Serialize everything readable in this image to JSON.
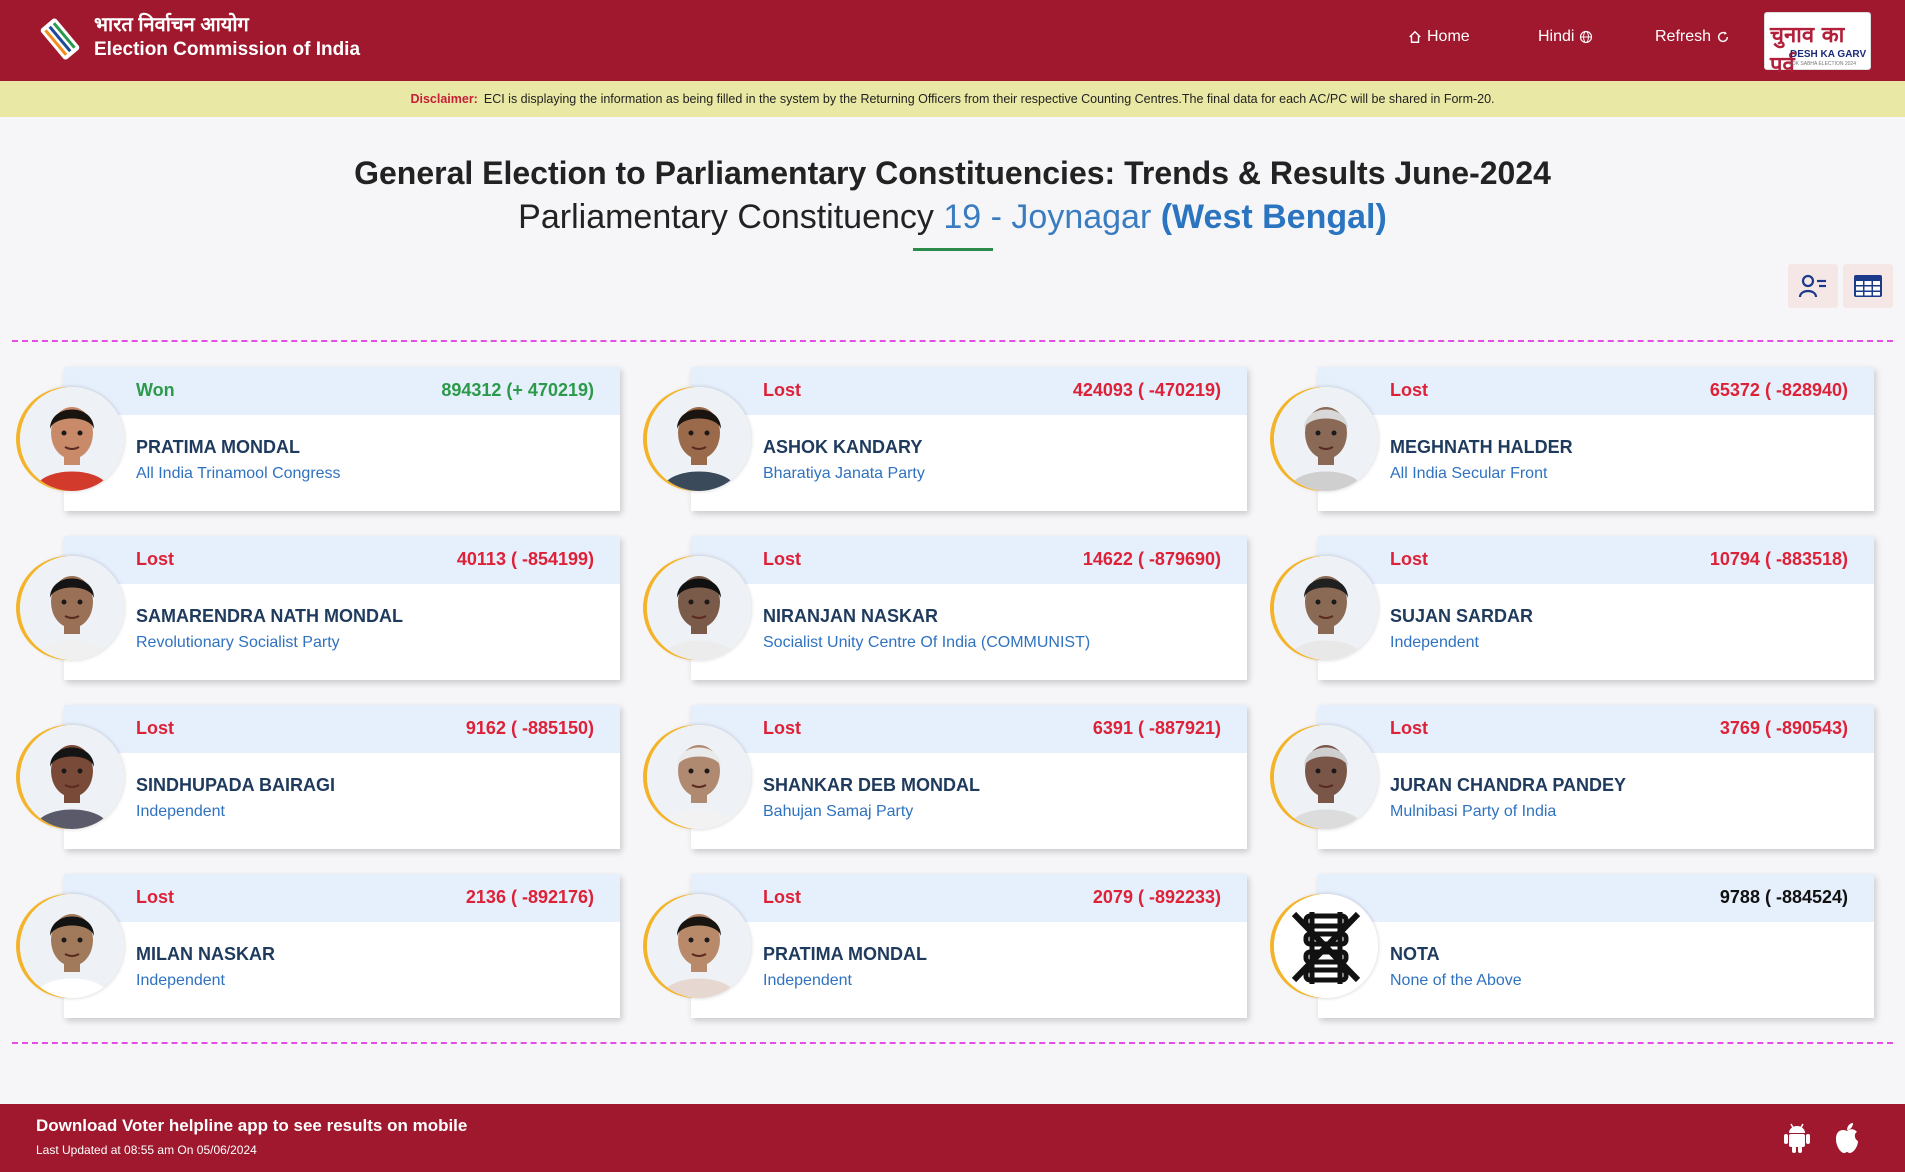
{
  "header": {
    "title_hindi": "भारत निर्वाचन आयोग",
    "title_english": "Election Commission of India",
    "nav": {
      "home": "Home",
      "hindi": "Hindi",
      "refresh": "Refresh"
    },
    "badge_hindi": "चुनाव का पर्व",
    "badge_english": "DESH KA GARV",
    "badge_small": "LOK SABHA ELECTION 2024"
  },
  "disclaimer": {
    "label": "Disclaimer:",
    "text": "ECI is displaying the information as being filled in the system by the Returning Officers from their respective Counting Centres.The final data for each AC/PC will be shared in Form-20."
  },
  "page": {
    "title": "General Election to Parliamentary Constituencies: Trends & Results June-2024",
    "subtitle_prefix": "Parliamentary Constituency",
    "constituency": "19 - Joynagar",
    "state": "(West Bengal)"
  },
  "candidates": [
    {
      "status": "Won",
      "votes": "894312 (+ 470219)",
      "name": "PRATIMA MONDAL",
      "party": "All India Trinamool Congress",
      "skin": "#c98a6a",
      "hair": "#1a1410",
      "shirt": "#d23b2c"
    },
    {
      "status": "Lost",
      "votes": "424093 ( -470219)",
      "name": "ASHOK KANDARY",
      "party": "Bharatiya Janata Party",
      "skin": "#9a6a4a",
      "hair": "#1a1410",
      "shirt": "#3a4a5a"
    },
    {
      "status": "Lost",
      "votes": "65372 ( -828940)",
      "name": "MEGHNATH HALDER",
      "party": "All India Secular Front",
      "skin": "#8a6a56",
      "hair": "#d8d8d8",
      "shirt": "#cfcfcf"
    },
    {
      "status": "Lost",
      "votes": "40113 ( -854199)",
      "name": "SAMARENDRA NATH MONDAL",
      "party": "Revolutionary Socialist Party",
      "skin": "#9a7056",
      "hair": "#141414",
      "shirt": "#f0f0f0"
    },
    {
      "status": "Lost",
      "votes": "14622 ( -879690)",
      "name": "NIRANJAN NASKAR",
      "party": "Socialist Unity Centre Of India (COMMUNIST)",
      "skin": "#7a5a48",
      "hair": "#101010",
      "shirt": "#ececec"
    },
    {
      "status": "Lost",
      "votes": "10794 ( -883518)",
      "name": "SUJAN SARDAR",
      "party": "Independent",
      "skin": "#8a6a55",
      "hair": "#202020",
      "shirt": "#e8e8e8"
    },
    {
      "status": "Lost",
      "votes": "9162 ( -885150)",
      "name": "SINDHUPADA BAIRAGI",
      "party": "Independent",
      "skin": "#7a4a38",
      "hair": "#141414",
      "shirt": "#5a5a6a"
    },
    {
      "status": "Lost",
      "votes": "6391 ( -887921)",
      "name": "SHANKAR DEB MONDAL",
      "party": "Bahujan Samaj Party",
      "skin": "#b08a70",
      "hair": "#eaeaea",
      "shirt": "#f2f2f2"
    },
    {
      "status": "Lost",
      "votes": "3769 ( -890543)",
      "name": "JURAN CHANDRA PANDEY",
      "party": "Mulnibasi Party of India",
      "skin": "#7a5648",
      "hair": "#cfcfcf",
      "shirt": "#dcdcdc"
    },
    {
      "status": "Lost",
      "votes": "2136 ( -892176)",
      "name": "MILAN NASKAR",
      "party": "Independent",
      "skin": "#a07a5a",
      "hair": "#121212",
      "shirt": "#ffffff"
    },
    {
      "status": "Lost",
      "votes": "2079 ( -892233)",
      "name": "PRATIMA MONDAL",
      "party": "Independent",
      "skin": "#b88a6a",
      "hair": "#1a1410",
      "shirt": "#e6d8d0"
    },
    {
      "status": "",
      "votes": "9788 ( -884524)",
      "name": "NOTA",
      "party": "None of the Above",
      "nota": true
    }
  ],
  "footer": {
    "line1": "Download Voter helpline app to see results on mobile",
    "line2": "Last Updated at 08:55 am On 05/06/2024"
  },
  "colors": {
    "brand": "#9f182d",
    "won": "#2b9a4a",
    "lost": "#dd2238",
    "accent": "#f4b42a",
    "disclaimer_bg": "#e9e8a4"
  }
}
